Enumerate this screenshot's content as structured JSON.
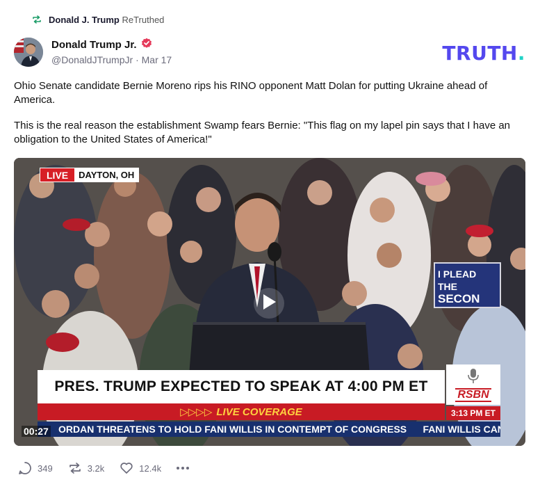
{
  "retruth": {
    "icon": "retruth-icon",
    "user": "Donald J. Trump",
    "action": "ReTruthed"
  },
  "author": {
    "name": "Donald Trump Jr.",
    "verified_icon": "verified-badge-icon",
    "handle": "@DonaldJTrumpJr",
    "separator": "·",
    "date": "Mar 17"
  },
  "brand": {
    "logo_text": "TRUTH",
    "logo_dot": ".",
    "color": "#5448ee",
    "accent": "#22d3c7"
  },
  "post": {
    "paragraphs": [
      "Ohio Senate candidate Bernie Moreno rips his RINO opponent Matt Dolan for putting Ukraine ahead of America.",
      "This is the real reason the establishment Swamp fears Bernie: \"This flag on my lapel pin says that I have an obligation to the United States of America!\""
    ]
  },
  "video": {
    "live_label": "LIVE",
    "location": "DAYTON, OH",
    "sign_text_1": "I PLEAD THE",
    "sign_text_2": "SECON",
    "headline": "PRES. TRUMP EXPECTED TO SPEAK AT 4:00 PM ET",
    "coverage_arrows": "▷▷▷▷",
    "coverage_label": "LIVE COVERAGE",
    "ticker": "ORDAN THREATENS TO HOLD FANI WILLIS IN CONTEMPT OF CONGRESS      FANI WILLIS CAN STAY",
    "network": "RSBN",
    "clock": "3:13 PM ET",
    "duration": "00:27",
    "play_icon": "play-icon"
  },
  "actions": {
    "replies": {
      "icon": "reply-icon",
      "count": "349"
    },
    "retruths": {
      "icon": "retruth-icon",
      "count": "3.2k"
    },
    "likes": {
      "icon": "heart-icon",
      "count": "12.4k"
    },
    "more_icon": "more-icon"
  }
}
